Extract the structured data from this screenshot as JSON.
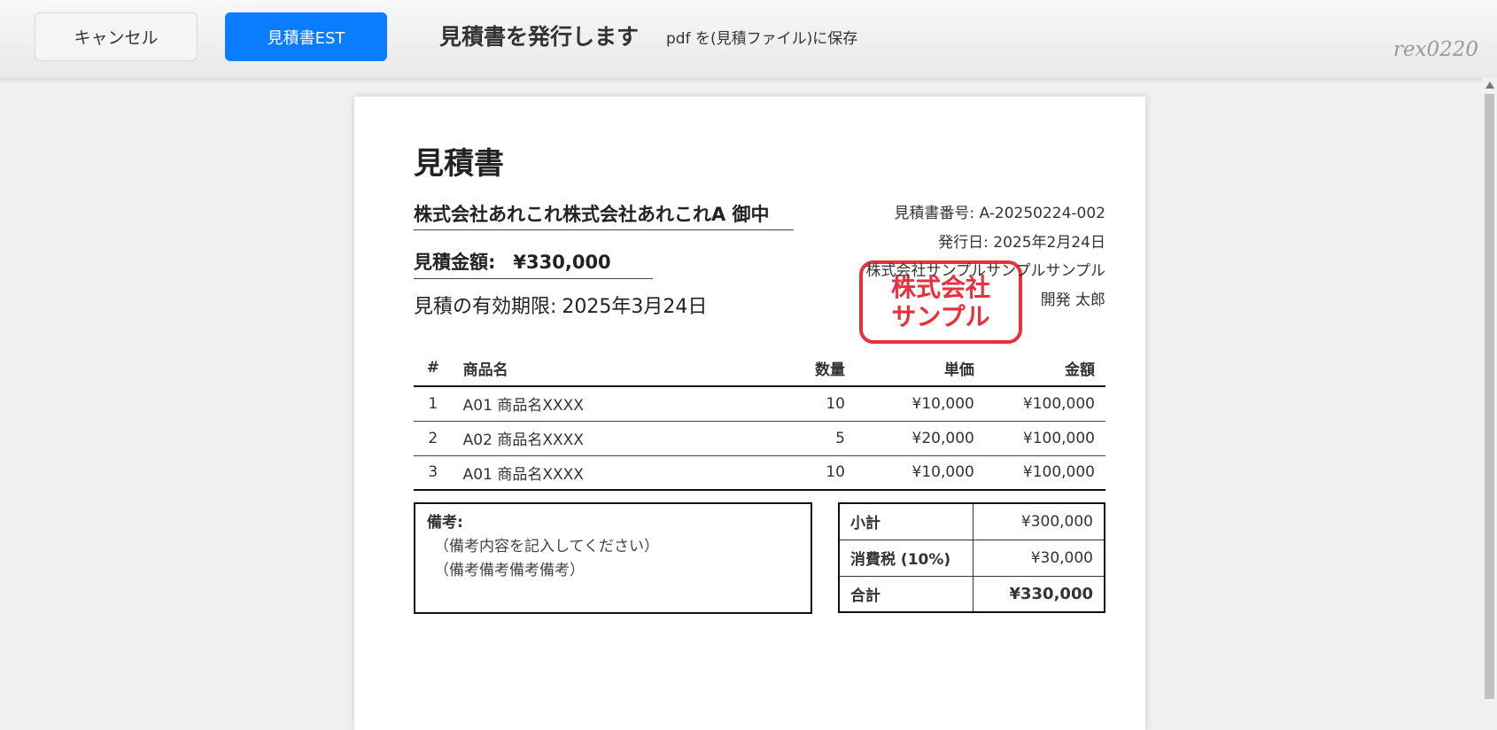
{
  "toolbar": {
    "cancel_label": "キャンセル",
    "est_label": "見積書EST",
    "heading": "見積書を発行します",
    "subtext": "pdf を(見積ファイル)に保存",
    "watermark": "rex0220",
    "accent_color": "#0a7cff"
  },
  "document": {
    "title": "見積書",
    "client": "株式会社あれこれ株式会社あれこれA 御中",
    "amount_label": "見積金額:",
    "amount_value": "¥330,000",
    "validity_label": "見積の有効期限:",
    "validity_value": "2025年3月24日",
    "quote_number": "見積書番号: A-20250224-002",
    "issue_date": "発行日: 2025年2月24日",
    "issuer_company": "株式会社サンプルサンプルサンプル",
    "issuer_person": "開発 太郎",
    "stamp_line1": "株式会社",
    "stamp_line2": "サンプル",
    "stamp_color": "#e8313d"
  },
  "items_table": {
    "headers": [
      "#",
      "商品名",
      "数量",
      "単価",
      "金額"
    ],
    "rows": [
      [
        "1",
        "A01 商品名XXXX",
        "10",
        "¥10,000",
        "¥100,000"
      ],
      [
        "2",
        "A02 商品名XXXX",
        "5",
        "¥20,000",
        "¥100,000"
      ],
      [
        "3",
        "A01 商品名XXXX",
        "10",
        "¥10,000",
        "¥100,000"
      ]
    ]
  },
  "notes": {
    "label": "備考:",
    "lines": [
      "（備考内容を記入してください）",
      "（備考備考備考備考）"
    ]
  },
  "totals": {
    "subtotal_label": "小計",
    "subtotal_value": "¥300,000",
    "tax_label": "消費税 (10%)",
    "tax_value": "¥30,000",
    "total_label": "合計",
    "total_value": "¥330,000"
  }
}
